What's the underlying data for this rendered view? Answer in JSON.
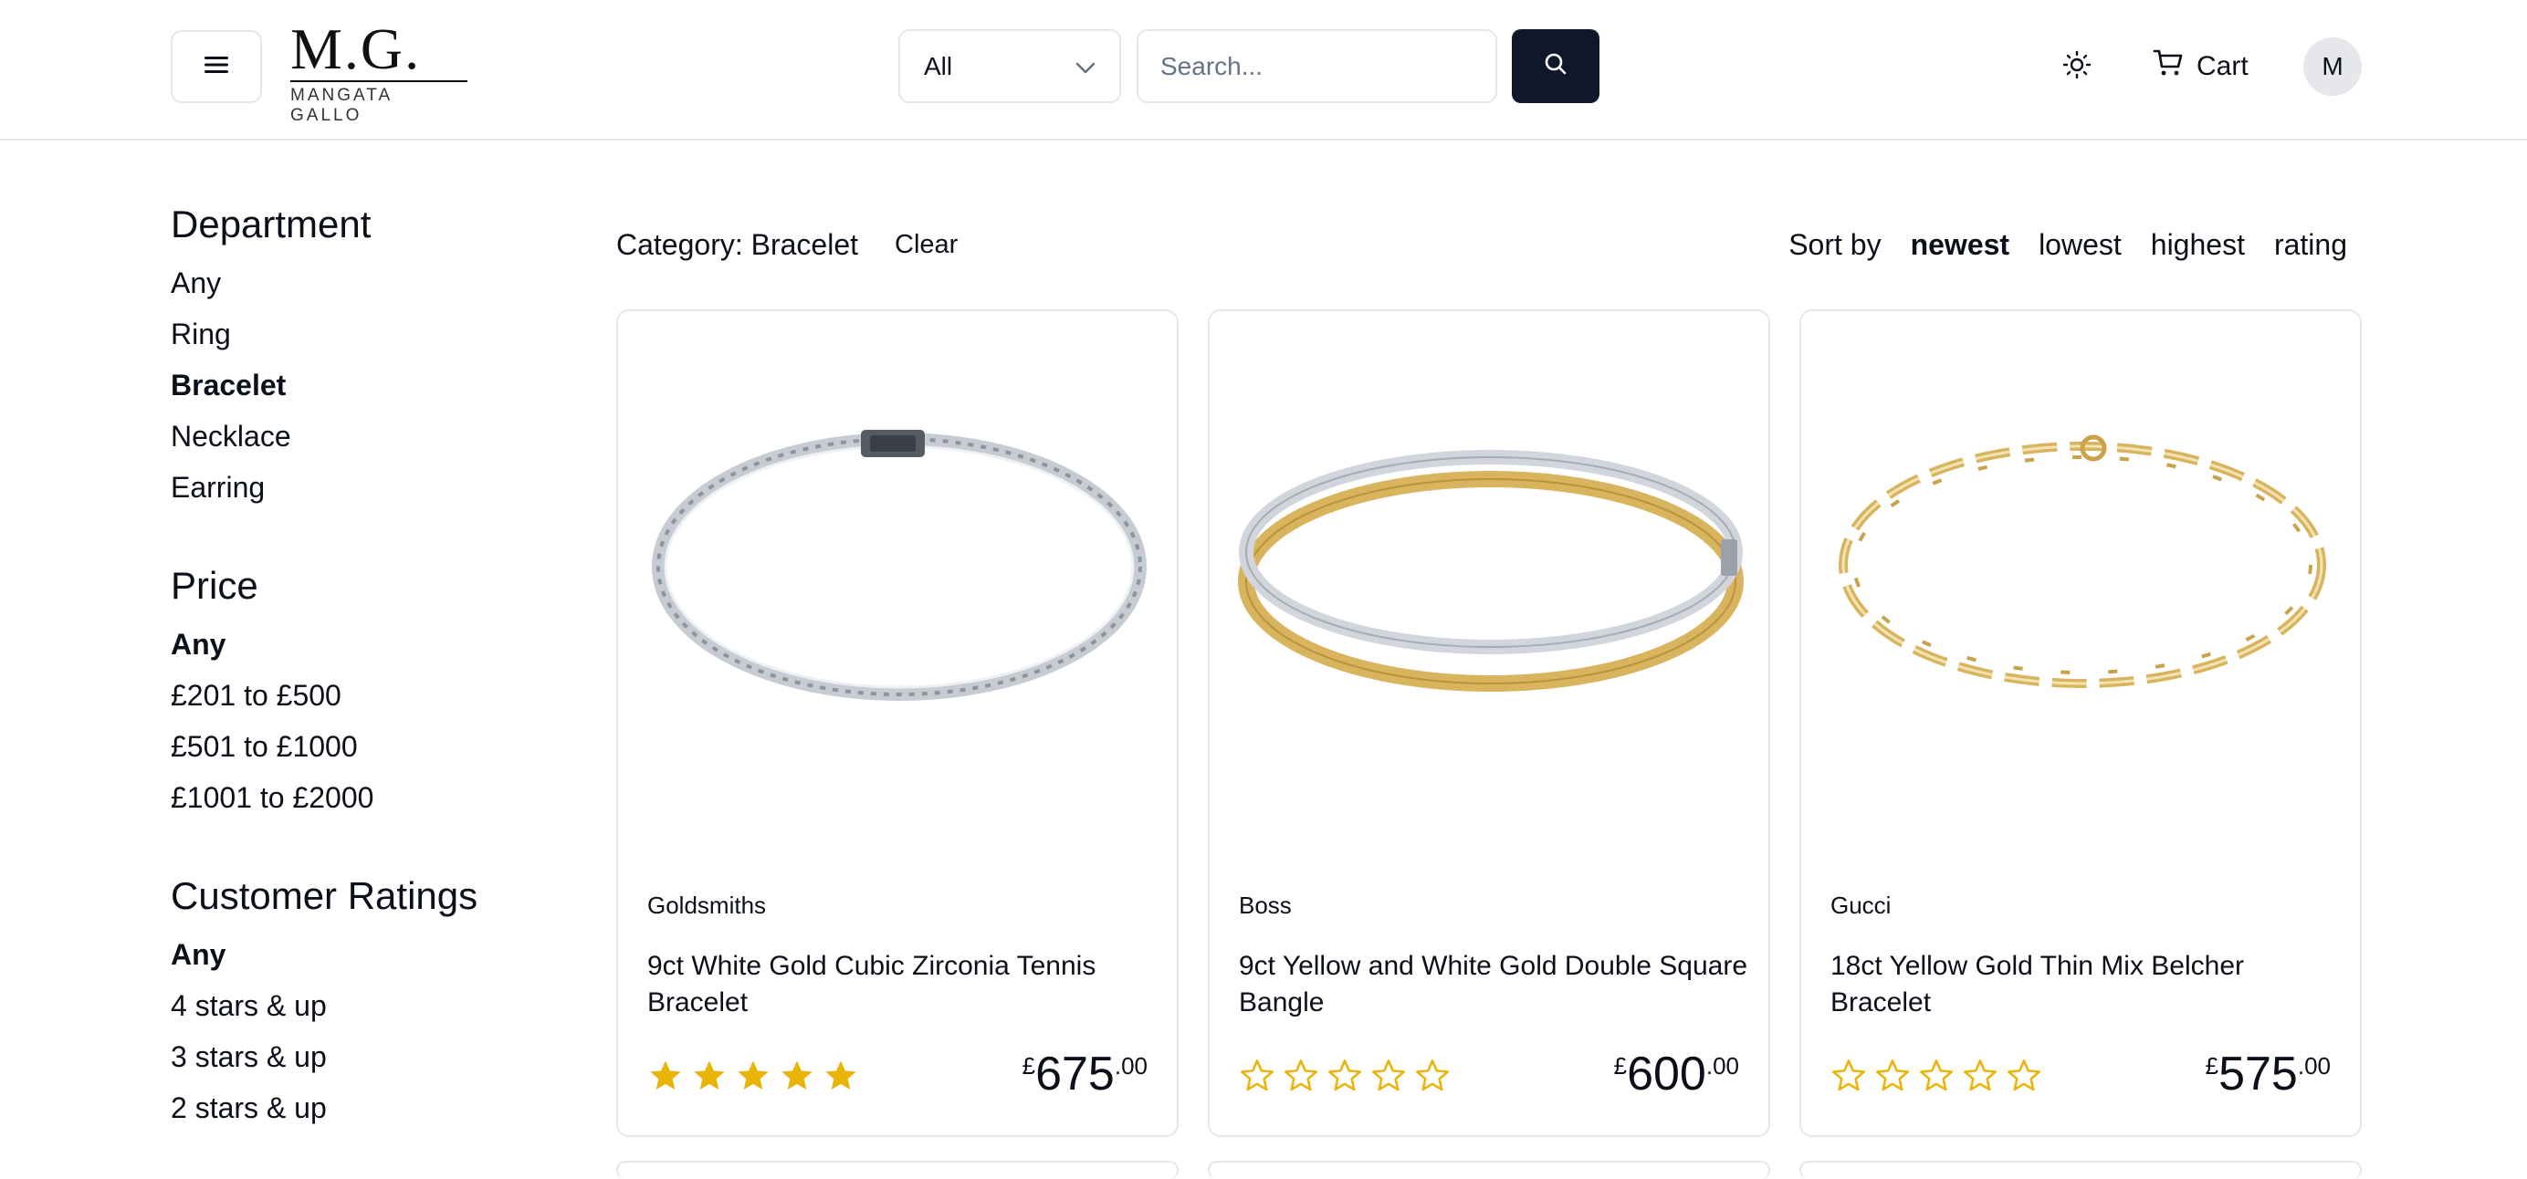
{
  "header": {
    "menu_icon": "hamburger-icon",
    "logo": {
      "mark": "M.G.",
      "sub": "MANGATA GALLO"
    },
    "category_select": {
      "value": "All",
      "icon": "chevron-down-icon"
    },
    "search": {
      "placeholder": "Search...",
      "value": "",
      "button_icon": "search-icon"
    },
    "theme_icon": "sun-icon",
    "cart": {
      "label": "Cart",
      "icon": "cart-icon"
    },
    "avatar_initial": "M"
  },
  "filters": {
    "department": {
      "title": "Department",
      "options": [
        "Any",
        "Ring",
        "Bracelet",
        "Necklace",
        "Earring"
      ],
      "selected": "Bracelet"
    },
    "price": {
      "title": "Price",
      "options": [
        "Any",
        "£201 to £500",
        "£501 to £1000",
        "£1001 to £2000"
      ],
      "selected": "Any"
    },
    "ratings": {
      "title": "Customer Ratings",
      "options": [
        "Any",
        "4 stars & up",
        "3 stars & up",
        "2 stars & up"
      ],
      "selected": "Any"
    }
  },
  "toolbar": {
    "category_label": "Category: Bracelet",
    "clear_label": "Clear",
    "sort_label": "Sort by",
    "sort_options": [
      "newest",
      "lowest",
      "highest",
      "rating"
    ],
    "sort_selected": "newest"
  },
  "products": [
    {
      "brand": "Goldsmiths",
      "name": "9ct White Gold Cubic Zirconia Tennis Bracelet",
      "currency": "£",
      "price_whole": "675",
      "price_cents": ".00",
      "rating": 5,
      "image": "tennis-bracelet-image"
    },
    {
      "brand": "Boss",
      "name": "9ct Yellow and White Gold Double Square Bangle",
      "currency": "£",
      "price_whole": "600",
      "price_cents": ".00",
      "rating": 0,
      "image": "double-bangle-image"
    },
    {
      "brand": "Gucci",
      "name": "18ct Yellow Gold Thin Mix Belcher Bracelet",
      "currency": "£",
      "price_whole": "575",
      "price_cents": ".00",
      "rating": 0,
      "image": "belcher-bracelet-image"
    }
  ],
  "colors": {
    "primary": "#0f172a",
    "border": "#e5e7eb",
    "star": "#eab308",
    "silver": "#c7ccd3",
    "gold": "#d9b45e"
  }
}
